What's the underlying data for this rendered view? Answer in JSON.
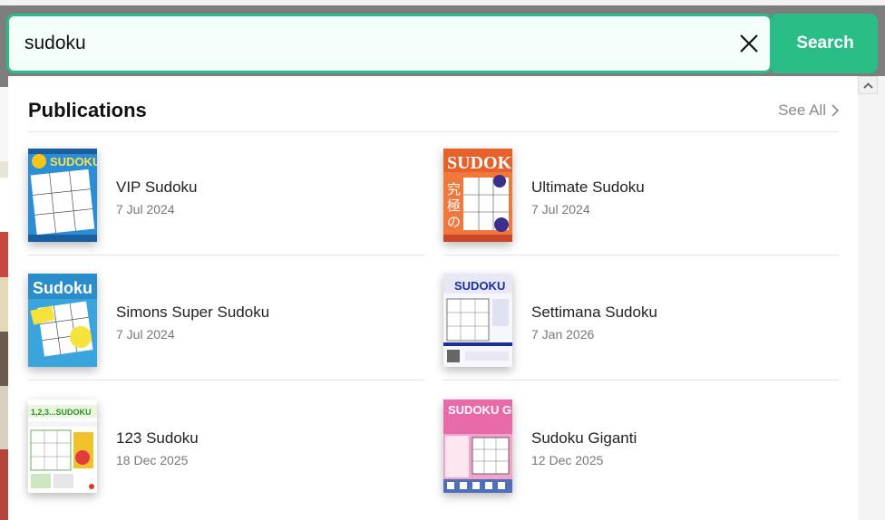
{
  "search": {
    "value": "sudoku",
    "button_label": "Search"
  },
  "publications": {
    "heading": "Publications",
    "see_all_label": "See All",
    "items": [
      {
        "title": "VIP Sudoku",
        "date": "7 Jul 2024",
        "cover_text": "SUDOKU"
      },
      {
        "title": "Ultimate Sudoku",
        "date": "7 Jul 2024",
        "cover_text": "SUDOKU"
      },
      {
        "title": "Simons Super Sudoku",
        "date": "7 Jul 2024",
        "cover_text": "Sudoku"
      },
      {
        "title": "Settimana Sudoku",
        "date": "7 Jan 2026",
        "cover_text": "SUDOKU"
      },
      {
        "title": "123 Sudoku",
        "date": "18 Dec 2025",
        "cover_text": "1,2,3...SUDOKU"
      },
      {
        "title": "Sudoku Giganti",
        "date": "12 Dec 2025",
        "cover_text": "SUDOKU GIGANTI"
      }
    ]
  },
  "colors": {
    "accent": "#2bbd86",
    "search_bg": "#f4fffb"
  }
}
